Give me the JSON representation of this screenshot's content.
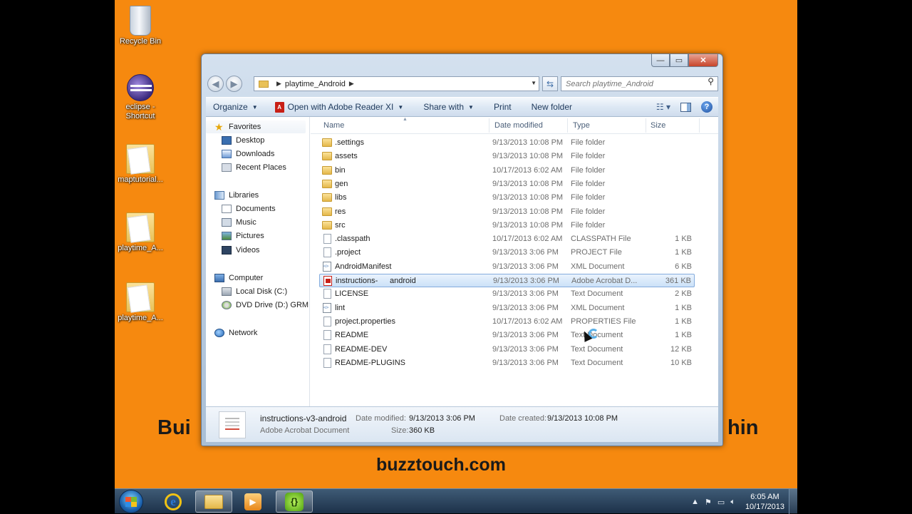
{
  "desktop": {
    "icons": [
      {
        "label": "Recycle Bin"
      },
      {
        "label": "eclipse - Shortcut"
      },
      {
        "label": "maptutorial..."
      },
      {
        "label": "playtime_A..."
      },
      {
        "label": "playtime_A..."
      }
    ],
    "banner_left": "Bui",
    "banner_right": "hin",
    "banner_site": "buzztouch.com"
  },
  "window": {
    "caption": {
      "minimize": "—",
      "maximize": "▭",
      "close": "✕"
    },
    "address": {
      "crumb": "playtime_Android"
    },
    "search_placeholder": "Search playtime_Android",
    "toolbar": {
      "organize": "Organize",
      "open_with": "Open with Adobe Reader XI",
      "share_with": "Share with",
      "print": "Print",
      "new_folder": "New folder"
    },
    "nav": {
      "favorites": "Favorites",
      "desktop": "Desktop",
      "downloads": "Downloads",
      "recent": "Recent Places",
      "libraries": "Libraries",
      "documents": "Documents",
      "music": "Music",
      "pictures": "Pictures",
      "videos": "Videos",
      "computer": "Computer",
      "local_disk": "Local Disk (C:)",
      "dvd": "DVD Drive (D:) GRM",
      "network": "Network"
    },
    "columns": {
      "name": "Name",
      "date": "Date modified",
      "type": "Type",
      "size": "Size"
    },
    "files": [
      {
        "name": ".settings",
        "date": "9/13/2013 10:08 PM",
        "type": "File folder",
        "size": "",
        "icon": "folder-icon"
      },
      {
        "name": "assets",
        "date": "9/13/2013 10:08 PM",
        "type": "File folder",
        "size": "",
        "icon": "folder-icon"
      },
      {
        "name": "bin",
        "date": "10/17/2013 6:02 AM",
        "type": "File folder",
        "size": "",
        "icon": "folder-icon"
      },
      {
        "name": "gen",
        "date": "9/13/2013 10:08 PM",
        "type": "File folder",
        "size": "",
        "icon": "folder-icon"
      },
      {
        "name": "libs",
        "date": "9/13/2013 10:08 PM",
        "type": "File folder",
        "size": "",
        "icon": "folder-icon"
      },
      {
        "name": "res",
        "date": "9/13/2013 10:08 PM",
        "type": "File folder",
        "size": "",
        "icon": "folder-icon"
      },
      {
        "name": "src",
        "date": "9/13/2013 10:08 PM",
        "type": "File folder",
        "size": "",
        "icon": "folder-icon"
      },
      {
        "name": ".classpath",
        "date": "10/17/2013 6:02 AM",
        "type": "CLASSPATH File",
        "size": "1 KB",
        "icon": "file-icon"
      },
      {
        "name": ".project",
        "date": "9/13/2013 3:06 PM",
        "type": "PROJECT File",
        "size": "1 KB",
        "icon": "file-icon"
      },
      {
        "name": "AndroidManifest",
        "date": "9/13/2013 3:06 PM",
        "type": "XML Document",
        "size": "6 KB",
        "icon": "xml-file-icon"
      },
      {
        "name": "instructions-",
        "name_tail": "android",
        "date": "9/13/2013 3:06 PM",
        "type": "Adobe Acrobat D...",
        "size": "361 KB",
        "icon": "pdf-file-icon",
        "selected": true
      },
      {
        "name": "LICENSE",
        "date": "9/13/2013 3:06 PM",
        "type": "Text Document",
        "size": "2 KB",
        "icon": "file-icon"
      },
      {
        "name": "lint",
        "date": "9/13/2013 3:06 PM",
        "type": "XML Document",
        "size": "1 KB",
        "icon": "xml-file-icon"
      },
      {
        "name": "project.properties",
        "date": "10/17/2013 6:02 AM",
        "type": "PROPERTIES File",
        "size": "1 KB",
        "icon": "file-icon"
      },
      {
        "name": "README",
        "date": "9/13/2013 3:06 PM",
        "type": "Text Document",
        "size": "1 KB",
        "icon": "file-icon"
      },
      {
        "name": "README-DEV",
        "date": "9/13/2013 3:06 PM",
        "type": "Text Document",
        "size": "12 KB",
        "icon": "file-icon"
      },
      {
        "name": "README-PLUGINS",
        "date": "9/13/2013 3:06 PM",
        "type": "Text Document",
        "size": "10 KB",
        "icon": "file-icon"
      }
    ],
    "details": {
      "filename": "instructions-v3-android",
      "filetype": "Adobe Acrobat Document",
      "modified_label": "Date modified:",
      "modified_value": "9/13/2013 3:06 PM",
      "size_label": "Size:",
      "size_value": "360 KB",
      "created_label": "Date created:",
      "created_value": "9/13/2013 10:08 PM"
    }
  },
  "taskbar": {
    "time": "6:05 AM",
    "date": "10/17/2013"
  }
}
